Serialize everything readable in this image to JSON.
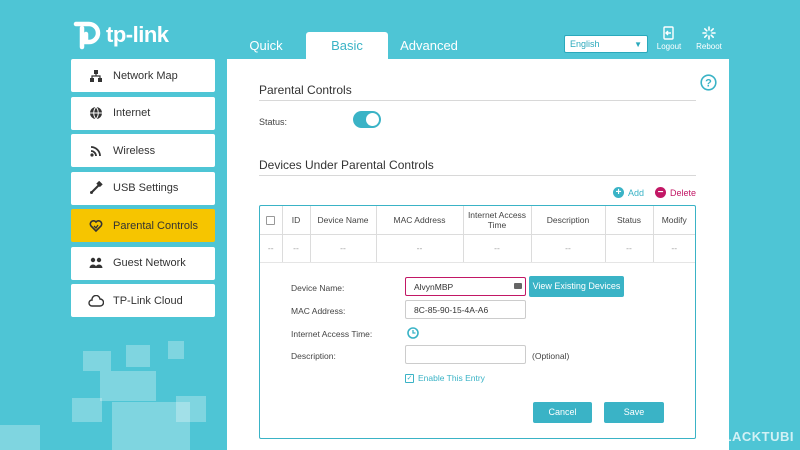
{
  "brand": {
    "name": "tp-link"
  },
  "top_tabs": [
    {
      "label": "Quick Setup"
    },
    {
      "label": "Basic"
    },
    {
      "label": "Advanced"
    }
  ],
  "language": {
    "selected": "English"
  },
  "top_actions": {
    "logout_label": "Logout",
    "reboot_label": "Reboot"
  },
  "sidebar": {
    "items": [
      {
        "label": "Network Map",
        "icon": "network-map-icon"
      },
      {
        "label": "Internet",
        "icon": "globe-icon"
      },
      {
        "label": "Wireless",
        "icon": "wireless-icon"
      },
      {
        "label": "USB Settings",
        "icon": "usb-icon"
      },
      {
        "label": "Parental Controls",
        "icon": "parental-heart-icon",
        "active": true
      },
      {
        "label": "Guest Network",
        "icon": "guest-icon"
      },
      {
        "label": "TP-Link Cloud",
        "icon": "cloud-icon"
      }
    ]
  },
  "parental_controls": {
    "title": "Parental Controls",
    "status_label": "Status:",
    "status_on": true
  },
  "devices_section": {
    "title": "Devices Under Parental Controls",
    "add_label": "Add",
    "delete_label": "Delete",
    "columns": [
      "ID",
      "Device Name",
      "MAC Address",
      "Internet Access Time",
      "Description",
      "Status",
      "Modify"
    ],
    "empty_row": [
      "--",
      "--",
      "--",
      "--",
      "--",
      "--",
      "--",
      "--"
    ]
  },
  "form": {
    "device_name_label": "Device Name:",
    "device_name_value": "AlvynMBP",
    "view_existing_label": "View Existing Devices",
    "mac_label": "MAC Address:",
    "mac_value": "8C-85-90-15-4A-A6",
    "access_time_label": "Internet Access Time:",
    "description_label": "Description:",
    "description_value": "",
    "optional_label": "(Optional)",
    "enable_label": "Enable This Entry",
    "enable_checked": true,
    "cancel_label": "Cancel",
    "save_label": "Save"
  },
  "watermark": "BLACKTUBI",
  "colors": {
    "accent": "#3ab3c6",
    "background": "#4ec5d5",
    "active_item": "#f6c500",
    "delete": "#c21765"
  }
}
